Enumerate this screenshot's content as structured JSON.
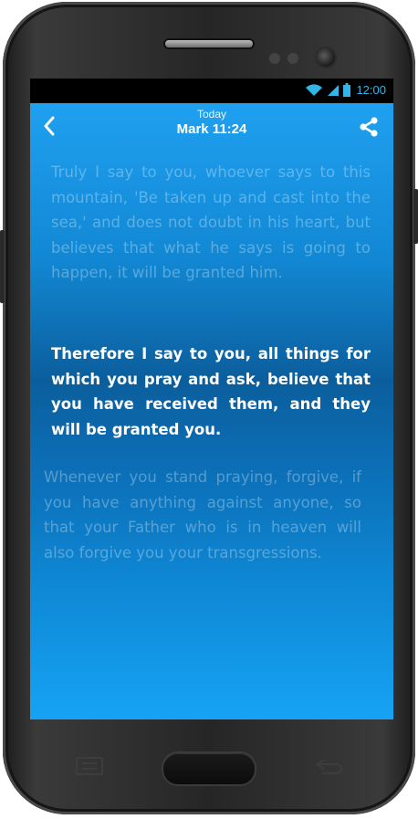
{
  "status_bar": {
    "time": "12:00",
    "icons": [
      "wifi-icon",
      "signal-icon",
      "battery-icon"
    ],
    "color": "#33b5e5"
  },
  "app_bar": {
    "subtitle": "Today",
    "title": "Mark 11:24",
    "back_icon": "chevron-left-icon",
    "share_icon": "share-icon"
  },
  "verses": {
    "previous": "Truly I say to you, whoever says to this mountain, 'Be taken up and cast into the sea,' and does not doubt in his heart, but believes that what he says is going to happen, it will be granted him.",
    "current": "Therefore I say to you, all things for which you pray and ask, believe that you have received them, and they will be granted you.",
    "next": "Whenever you stand praying, forgive, if you have anything against anyone, so that your Father who is in heaven will also forgive you your transgressions."
  },
  "colors": {
    "background_top": "#1fa0f0",
    "background_mid": "#0b5e9c",
    "background_bottom": "#16a3f5"
  },
  "hardware_keys": [
    "menu-key-icon",
    "home-key",
    "back-key-icon"
  ]
}
